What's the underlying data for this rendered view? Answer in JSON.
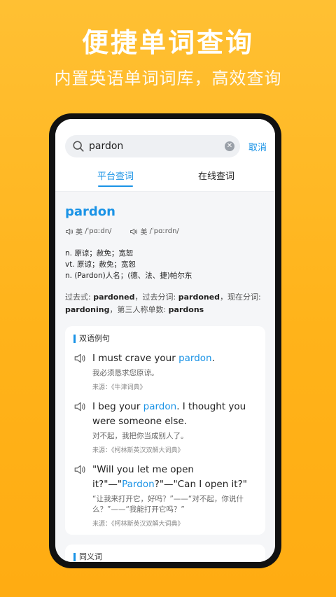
{
  "promo": {
    "headline": "便捷单词查询",
    "subline": "内置英语单词词库，高效查询"
  },
  "search": {
    "value": "pardon",
    "cancel_label": "取消"
  },
  "tabs": [
    {
      "label": "平台查词",
      "active": true
    },
    {
      "label": "在线查词",
      "active": false
    }
  ],
  "entry": {
    "word": "pardon",
    "phonetics": [
      {
        "region": "英",
        "ipa": "/ˈpɑːdn/"
      },
      {
        "region": "美",
        "ipa": "/ˈpɑːrdn/"
      }
    ],
    "definitions": [
      "n. 原谅；赦免；宽恕",
      "vt. 原谅；赦免；宽恕",
      "n. (Pardon)人名；(德、法、捷)帕尔东"
    ],
    "forms": {
      "past_label": "过去式: ",
      "past": "pardoned",
      "pp_label": "，过去分词: ",
      "pp": "pardoned",
      "ing_label": "，现在分词: ",
      "ing": "pardoning",
      "third_label": "，第三人称单数: ",
      "third": "pardons"
    }
  },
  "examples": {
    "title": "双语例句",
    "items": [
      {
        "en_pre": "I must crave your ",
        "en_hl": "pardon",
        "en_post": ".",
        "zh": "我必须恳求您原谅。",
        "source": "来源：《牛津词典》"
      },
      {
        "en_pre": "I beg your ",
        "en_hl": "pardon",
        "en_post": ". I thought you were someone else.",
        "zh": "对不起，我把你当成别人了。",
        "source": "来源：《柯林斯英汉双解大词典》"
      },
      {
        "en_pre": "\"Will you let me open it?\"—\"",
        "en_hl": "Pardon",
        "en_post": "?\"—\"Can I open it?\"",
        "zh": "“让我来打开它，好吗？”——“对不起，你说什么？”——“我能打开它吗？”",
        "source": "来源：《柯林斯英汉双解大词典》"
      }
    ]
  },
  "synonyms": {
    "title": "同义词"
  },
  "colors": {
    "accent": "#1a93e6",
    "background_top": "#ffc033",
    "background_bottom": "#ffac12"
  }
}
